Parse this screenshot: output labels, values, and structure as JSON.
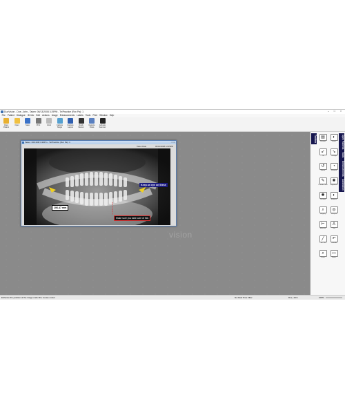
{
  "window": {
    "title": "DuoVision - Doe, John - Taken: 06/13/2008 3:29PM - Te/Practice (Rvc Pa): 1"
  },
  "menu": [
    "File",
    "Patient",
    "Dialogue",
    "ID Info",
    "Edit",
    "Actions",
    "Image",
    "Enhancements",
    "Labels",
    "Tools",
    "Print",
    "Window",
    "Help"
  ],
  "toolbar": [
    {
      "label": "Open Patient",
      "icon": "open-folder-icon",
      "color": "#e8b030"
    },
    {
      "label": "Open",
      "icon": "folder-icon",
      "color": "#f0c040"
    },
    {
      "label": "Save",
      "icon": "save-icon",
      "color": "#3b72c8"
    },
    {
      "label": "Print",
      "icon": "print-icon",
      "color": "#777777"
    },
    {
      "label": "Undo",
      "icon": "undo-icon",
      "color": "#bbbbbb"
    },
    {
      "label": "Capture Single",
      "icon": "camera-icon",
      "color": "#55a0d0"
    },
    {
      "label": "Capture Layout",
      "icon": "layout-icon",
      "color": "#3060b0"
    },
    {
      "label": "Quick Sensor",
      "icon": "sensor-icon",
      "color": "#333333"
    },
    {
      "label": "Capture Video",
      "icon": "video-icon",
      "color": "#5a80c0"
    },
    {
      "label": "Activate Scanner",
      "icon": "scanner-icon",
      "color": "#222222"
    }
  ],
  "image_window": {
    "title": "Taken: 06/13/08 3:29Pm - Te/Practice (Rvc Pa): 1",
    "info_left": "",
    "info_mid": "Taken Date",
    "info_right": "06/13/2008  12:25PM",
    "annotation_keep": "Keep an eye on these",
    "annotation_measure": "106.47 mm",
    "annotation_care": "Make sure you take care of this"
  },
  "watermark": "vision",
  "toolbox": {
    "tabs": [
      "Toolbox",
      "Open Patients",
      "Tools",
      "Enhancements",
      "Calibration"
    ],
    "tools": [
      {
        "label": "Preview",
        "glyph": "▤"
      },
      {
        "label": "Invert",
        "glyph": "◐"
      },
      {
        "label": "Tilt",
        "glyph": "↙"
      },
      {
        "label": "Tilt Right",
        "glyph": "↘"
      },
      {
        "label": "Rotate",
        "glyph": "↺"
      },
      {
        "label": "Sharpen",
        "glyph": "◔"
      },
      {
        "label": "Pseudo Color",
        "glyph": "✎"
      },
      {
        "label": "Brightness",
        "glyph": "✺"
      },
      {
        "label": "Contrast",
        "glyph": "✺"
      },
      {
        "label": "Emboss",
        "glyph": "◐"
      },
      {
        "label": "Magnify",
        "glyph": "⌕"
      },
      {
        "label": "Sharpen",
        "glyph": "◎"
      },
      {
        "label": "Measure",
        "glyph": "⊢"
      },
      {
        "label": "Text",
        "glyph": "A"
      },
      {
        "label": "Line Tool",
        "glyph": "╱"
      },
      {
        "label": "Undo All",
        "glyph": "↶"
      },
      {
        "label": "Zoom",
        "glyph": "⌕"
      },
      {
        "label": "Notes",
        "glyph": "▭"
      }
    ]
  },
  "status": {
    "left": "Enhance the position of the image under the mouse cursor",
    "mid": "No Real Time Filter",
    "right": "Doe, John",
    "zoom": "100%"
  },
  "colors": {
    "workspace": "#8a8a8a",
    "toolbox_tabs": "#16164f",
    "annotation_bg": "#1b1b80"
  }
}
